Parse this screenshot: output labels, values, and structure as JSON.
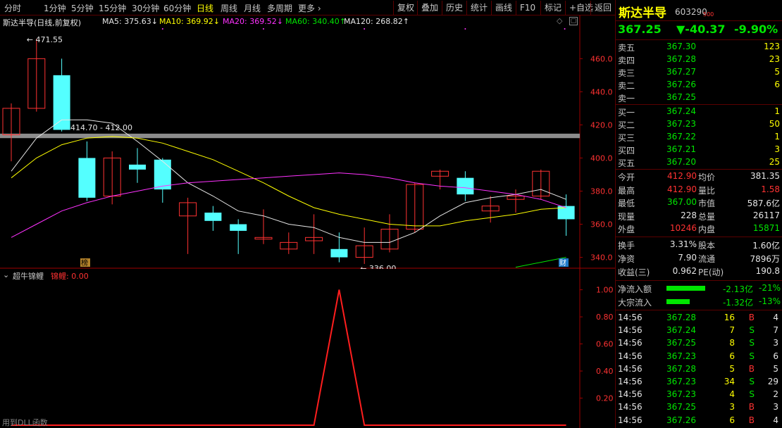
{
  "toolbar": {
    "periods": [
      "分时",
      "1分钟",
      "5分钟",
      "15分钟",
      "30分钟",
      "60分钟",
      "日线",
      "周线",
      "月线",
      "多周期",
      "更多 ›"
    ],
    "active_period": "日线",
    "buttons": [
      "复权",
      "叠加",
      "历史",
      "统计",
      "画线",
      "F10",
      "标记",
      "+自选",
      "返回"
    ]
  },
  "main": {
    "title": "斯达半导(日线,前复权)",
    "ma": [
      {
        "label": "MA5: 375.63↓",
        "color": "#e6e6e6"
      },
      {
        "label": "MA10: 369.92↓",
        "color": "#ffff00"
      },
      {
        "label": "MA20: 369.52↓",
        "color": "#ff32ff"
      },
      {
        "label": "MA60: 340.40↑",
        "color": "#00e600"
      },
      {
        "label": "MA120: 268.82↑",
        "color": "#e6e6e6"
      }
    ],
    "y_ticks": [
      "460.0",
      "440.0",
      "420.0",
      "400.0",
      "380.0",
      "360.0",
      "340.0"
    ],
    "annotations": {
      "high": "471.55",
      "low": "336.00",
      "band": "414.70 - 412.00",
      "badge_left": "榜",
      "badge_right": "财"
    }
  },
  "sub": {
    "title": "超牛锦鲤",
    "value_label": "锦鲤: 0.00",
    "y_ticks": [
      "1.00",
      "0.80",
      "0.60",
      "0.40",
      "0.20"
    ],
    "footer": "用到DLL函数"
  },
  "chart_data": [
    {
      "type": "candlestick",
      "title": "斯达半导(日线,前复权)",
      "ylim": [
        333,
        478
      ],
      "up_color": "#ff3232",
      "down_color": "#54ffff",
      "candles": [
        {
          "o": 414,
          "h": 433,
          "l": 398,
          "c": 430
        },
        {
          "o": 430,
          "h": 472,
          "l": 428,
          "c": 460
        },
        {
          "o": 450,
          "h": 460,
          "l": 416,
          "c": 417
        },
        {
          "o": 400,
          "h": 410,
          "l": 374,
          "c": 376
        },
        {
          "o": 377,
          "h": 404,
          "l": 372,
          "c": 400
        },
        {
          "o": 396,
          "h": 406,
          "l": 385,
          "c": 393
        },
        {
          "o": 399,
          "h": 400,
          "l": 373,
          "c": 381
        },
        {
          "o": 365,
          "h": 376,
          "l": 342,
          "c": 373
        },
        {
          "o": 367,
          "h": 371,
          "l": 356,
          "c": 362
        },
        {
          "o": 360,
          "h": 363,
          "l": 342,
          "c": 356
        },
        {
          "o": 351,
          "h": 369,
          "l": 348,
          "c": 352
        },
        {
          "o": 345,
          "h": 355,
          "l": 342,
          "c": 349
        },
        {
          "o": 350,
          "h": 366,
          "l": 342,
          "c": 352
        },
        {
          "o": 345,
          "h": 355,
          "l": 337,
          "c": 340
        },
        {
          "o": 340,
          "h": 358,
          "l": 336,
          "c": 347
        },
        {
          "o": 345,
          "h": 366,
          "l": 343,
          "c": 357
        },
        {
          "o": 357,
          "h": 385,
          "l": 355,
          "c": 384
        },
        {
          "o": 389,
          "h": 393,
          "l": 381,
          "c": 392
        },
        {
          "o": 388,
          "h": 392,
          "l": 374,
          "c": 378
        },
        {
          "o": 368,
          "h": 377,
          "l": 361,
          "c": 371
        },
        {
          "o": 375,
          "h": 381,
          "l": 367,
          "c": 377
        },
        {
          "o": 377,
          "h": 393,
          "l": 375,
          "c": 392
        },
        {
          "o": 371,
          "h": 378,
          "l": 353,
          "c": 363
        }
      ],
      "series": [
        {
          "name": "MA5",
          "values": [
            392,
            412,
            423,
            423,
            421,
            410,
            398,
            385,
            377,
            368,
            365,
            360,
            358,
            352,
            349,
            349,
            355,
            365,
            373,
            376,
            378,
            381,
            375
          ]
        },
        {
          "name": "MA10",
          "values": [
            388,
            400,
            408,
            412,
            413,
            412,
            409,
            404,
            399,
            392,
            385,
            377,
            370,
            366,
            363,
            360,
            359,
            359,
            362,
            364,
            366,
            369,
            370
          ]
        },
        {
          "name": "MA20",
          "values": [
            352,
            360,
            368,
            373,
            377,
            380,
            383,
            385,
            386,
            387,
            388,
            389,
            390,
            391,
            390,
            388,
            385,
            383,
            382,
            380,
            378,
            375,
            370
          ]
        },
        {
          "name": "MA60",
          "values": [
            null,
            null,
            null,
            null,
            null,
            null,
            null,
            null,
            null,
            null,
            null,
            null,
            null,
            null,
            null,
            null,
            null,
            null,
            null,
            null,
            334,
            337,
            340
          ]
        }
      ],
      "band": {
        "from": 412.0,
        "to": 414.7,
        "label": "414.70 - 412.00"
      }
    },
    {
      "type": "line",
      "title": "超牛锦鲤",
      "ylim": [
        0,
        1.05
      ],
      "series": [
        {
          "name": "锦鲤",
          "values": [
            0,
            0,
            0,
            0,
            0,
            0,
            0,
            0,
            0,
            0,
            0,
            0,
            0,
            1,
            0,
            0,
            0,
            0,
            0,
            0,
            0,
            0,
            0
          ]
        }
      ]
    }
  ],
  "quote": {
    "name": "斯达半导",
    "code": "603290",
    "code_sup": "500",
    "price": "367.25",
    "change": "▼-40.37",
    "pct": "-9.90%",
    "asks": [
      {
        "label": "卖五",
        "price": "367.30",
        "vol": "123"
      },
      {
        "label": "卖四",
        "price": "367.28",
        "vol": "23"
      },
      {
        "label": "卖三",
        "price": "367.27",
        "vol": "5"
      },
      {
        "label": "卖二",
        "price": "367.26",
        "vol": "6"
      },
      {
        "label": "卖一",
        "price": "367.25",
        "vol": ""
      }
    ],
    "bids": [
      {
        "label": "买一",
        "price": "367.24",
        "vol": "1"
      },
      {
        "label": "买二",
        "price": "367.23",
        "vol": "50"
      },
      {
        "label": "买三",
        "price": "367.22",
        "vol": "1"
      },
      {
        "label": "买四",
        "price": "367.21",
        "vol": "3"
      },
      {
        "label": "买五",
        "price": "367.20",
        "vol": "25"
      }
    ],
    "stats": [
      {
        "l1": "今开",
        "v1": "412.90",
        "c1": "red",
        "l2": "均价",
        "v2": "381.35",
        "c2": "wht"
      },
      {
        "l1": "最高",
        "v1": "412.90",
        "c1": "red",
        "l2": "量比",
        "v2": "1.58",
        "c2": "red"
      },
      {
        "l1": "最低",
        "v1": "367.00",
        "c1": "grn",
        "l2": "市值",
        "v2": "587.6亿",
        "c2": "wht"
      },
      {
        "l1": "现量",
        "v1": "228",
        "c1": "wht",
        "l2": "总量",
        "v2": "26117",
        "c2": "wht"
      },
      {
        "l1": "外盘",
        "v1": "10246",
        "c1": "red",
        "l2": "内盘",
        "v2": "15871",
        "c2": "grn"
      }
    ],
    "fin": [
      {
        "l1": "换手",
        "v1": "3.31%",
        "l2": "股本",
        "v2": "1.60亿"
      },
      {
        "l1": "净资",
        "v1": "7.90",
        "l2": "流通",
        "v2": "7896万"
      },
      {
        "l1": "收益(三)",
        "v1": "0.962",
        "l2": "PE(动)",
        "v2": "190.8"
      }
    ],
    "flows": [
      {
        "label": "净流入额",
        "value": "-2.13亿",
        "pct": "-21%",
        "fill": 0.72
      },
      {
        "label": "大宗流入",
        "value": "-1.32亿",
        "pct": "-13%",
        "fill": 0.44
      }
    ],
    "ticks": [
      {
        "t": "14:56",
        "p": "367.28",
        "v": "16",
        "s": "B",
        "n": "4"
      },
      {
        "t": "14:56",
        "p": "367.24",
        "v": "7",
        "s": "S",
        "n": "7"
      },
      {
        "t": "14:56",
        "p": "367.25",
        "v": "8",
        "s": "S",
        "n": "3"
      },
      {
        "t": "14:56",
        "p": "367.23",
        "v": "6",
        "s": "S",
        "n": "6"
      },
      {
        "t": "14:56",
        "p": "367.28",
        "v": "5",
        "s": "B",
        "n": "5"
      },
      {
        "t": "14:56",
        "p": "367.23",
        "v": "34",
        "s": "S",
        "n": "29"
      },
      {
        "t": "14:56",
        "p": "367.23",
        "v": "4",
        "s": "S",
        "n": "2"
      },
      {
        "t": "14:56",
        "p": "367.25",
        "v": "3",
        "s": "B",
        "n": "3"
      },
      {
        "t": "14:56",
        "p": "367.26",
        "v": "6",
        "s": "B",
        "n": "4"
      }
    ]
  }
}
